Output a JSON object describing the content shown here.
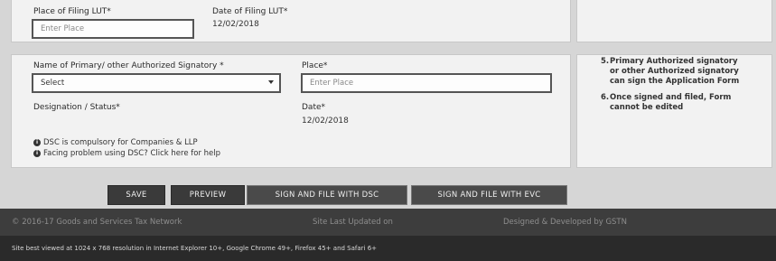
{
  "top_section": {
    "place_label": "Place of Filing LUT*",
    "place_placeholder": "Enter Place",
    "date_label": "Date of Filing LUT*",
    "date_value": "12/02/2018"
  },
  "signatory_section": {
    "signatory_label": "Name of Primary/ other Authorized Signatory *",
    "signatory_select_value": "Select",
    "place_label": "Place*",
    "place_placeholder": "Enter Place",
    "designation_label": "Designation / Status*",
    "date_label": "Date*",
    "date_value": "12/02/2018",
    "dsc_note": "DSC is compulsory for Companies & LLP",
    "dsc_help": "Facing problem using DSC? Click here for help"
  },
  "instructions": [
    {
      "num": "5.",
      "text": [
        "Primary Authorized signatory",
        "or other Authorized signatory",
        "can sign the Application Form"
      ]
    },
    {
      "num": "6.",
      "text": [
        "Once signed and filed, Form",
        "cannot be edited"
      ]
    }
  ],
  "buttons": {
    "save": "SAVE",
    "preview": "PREVIEW",
    "sign_dsc": "SIGN AND FILE WITH DSC",
    "sign_evc": "SIGN AND FILE WITH EVC"
  },
  "footer": {
    "copyright": "© 2016-17 Goods and Services Tax Network",
    "last_updated": "Site Last Updated on",
    "developed_by": "Designed & Developed by GSTN",
    "browser_note": "Site best viewed at 1024 x 768 resolution in Internet Explorer 10+, Google Chrome 49+, Firefox 45+ and Safari 6+"
  },
  "icons": {
    "info": "info-circle-icon",
    "dropdown": "chevron-down-icon"
  }
}
